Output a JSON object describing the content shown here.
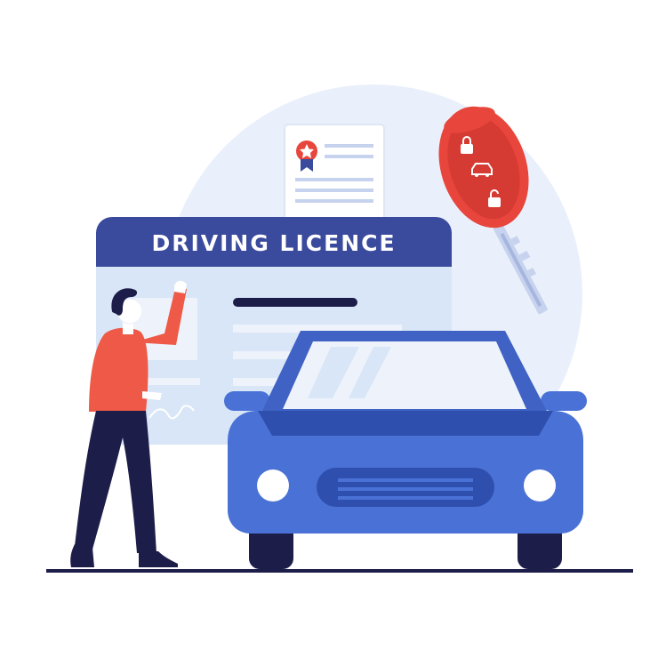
{
  "licence": {
    "title": "DRIVING LICENCE"
  },
  "colors": {
    "background": "#ffffff",
    "backdrop_circle": "#eaf0fb",
    "card_header": "#3a4a9c",
    "card_body": "#d8e6f7",
    "car_body": "#4a72d6",
    "car_dark": "#2f4fae",
    "key_fob": "#e8453c",
    "shirt": "#ee5a47",
    "pants": "#1d1d4a",
    "ground_line": "#1d1d4a"
  },
  "icons": [
    "certificate-icon",
    "award-ribbon-icon",
    "car-key-icon",
    "lock-icon",
    "unlock-icon",
    "car-icon"
  ]
}
